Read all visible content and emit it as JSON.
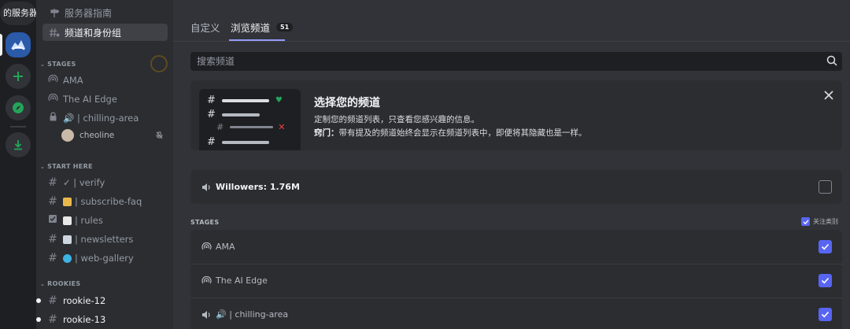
{
  "rail": {
    "server_label": "的服务器",
    "icons": [
      "server-icon",
      "add-server-icon",
      "explore-icon",
      "download-icon"
    ]
  },
  "sidebar": {
    "top_items": [
      {
        "label": "服务器指南",
        "icon": "signpost-icon"
      },
      {
        "label": "频道和身份组",
        "icon": "channels-roles-icon"
      }
    ],
    "categories": {
      "stages": "STAGES",
      "start_here": "START HERE",
      "rookies": "ROOKIES"
    },
    "stage_channels": [
      {
        "label": "AMA"
      },
      {
        "label": "The AI Edge"
      },
      {
        "label": "🔊 | chilling-area"
      }
    ],
    "voice_user": "cheoline",
    "start_channels": [
      {
        "label": "✓ | verify"
      },
      {
        "label": "| subscribe-faq"
      },
      {
        "label": "| rules"
      },
      {
        "label": "| newsletters"
      },
      {
        "label": "| web-gallery"
      }
    ],
    "rookie_channels": [
      {
        "label": "rookie-12"
      },
      {
        "label": "rookie-13"
      }
    ]
  },
  "main": {
    "tabs": [
      {
        "label": "自定义"
      },
      {
        "label": "浏览频道",
        "badge": "51"
      }
    ],
    "search_placeholder": "搜索频道",
    "banner": {
      "title": "选择您的频道",
      "description": "定制您的频道列表，只查看您感兴趣的信息。",
      "tip_prefix": "窍门：",
      "tip_text": "带有提及的频道始终会显示在频道列表中，即便将其隐藏也是一样。"
    },
    "willowers": {
      "label": "Willowers: 1.76M",
      "checked": false
    },
    "stages_section_label": "STAGES",
    "follow_category_label": "关注类别",
    "stage_rows": [
      {
        "label": "AMA",
        "checked": true
      },
      {
        "label": "The AI Edge",
        "checked": true
      },
      {
        "label": "🔊 | chilling-area",
        "checked": true
      }
    ]
  },
  "colors": {
    "accent": "#5865f2",
    "tab_underline": "#949cf7",
    "background": "#313338",
    "sidebar": "#2b2d31",
    "rail": "#1e1f22"
  }
}
